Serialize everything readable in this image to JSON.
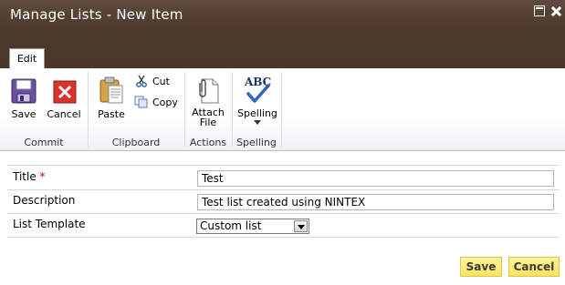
{
  "dialog": {
    "title": "Manage Lists - New Item"
  },
  "ribbon": {
    "tab": "Edit",
    "groups": {
      "commit": "Commit",
      "clipboard": "Clipboard",
      "actions": "Actions",
      "spelling": "Spelling"
    },
    "buttons": {
      "save": "Save",
      "cancel": "Cancel",
      "paste": "Paste",
      "cut": "Cut",
      "copy": "Copy",
      "attach_line1": "Attach",
      "attach_line2": "File",
      "spelling": "Spelling",
      "abc": "ABC"
    }
  },
  "form": {
    "title_label": "Title",
    "required_marker": "*",
    "title_value": "Test",
    "description_label": "Description",
    "description_value": "Test list created using NINTEX",
    "template_label": "List Template",
    "template_value": "Custom list"
  },
  "footer": {
    "save": "Save",
    "cancel": "Cancel"
  },
  "colors": {
    "titlebar": "#4e3a2d",
    "button_gold": "#fbe360",
    "required": "#bf0000"
  }
}
